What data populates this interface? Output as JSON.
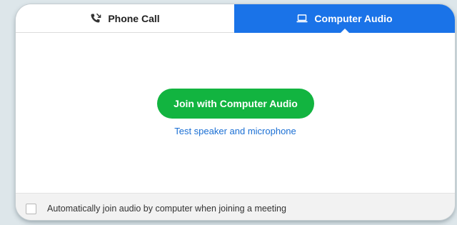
{
  "tabs": [
    {
      "label": "Phone Call",
      "icon": "phone-icon",
      "selected": false
    },
    {
      "label": "Computer Audio",
      "icon": "computer-icon",
      "selected": true
    }
  ],
  "main": {
    "join_button_label": "Join with Computer Audio",
    "test_link_label": "Test speaker and microphone"
  },
  "footer": {
    "checkbox_label": "Automatically join audio by computer when joining a meeting",
    "checkbox_checked": false
  },
  "colors": {
    "accent_blue": "#1a73e8",
    "join_green": "#12b440",
    "link_blue": "#1a6fd4"
  }
}
